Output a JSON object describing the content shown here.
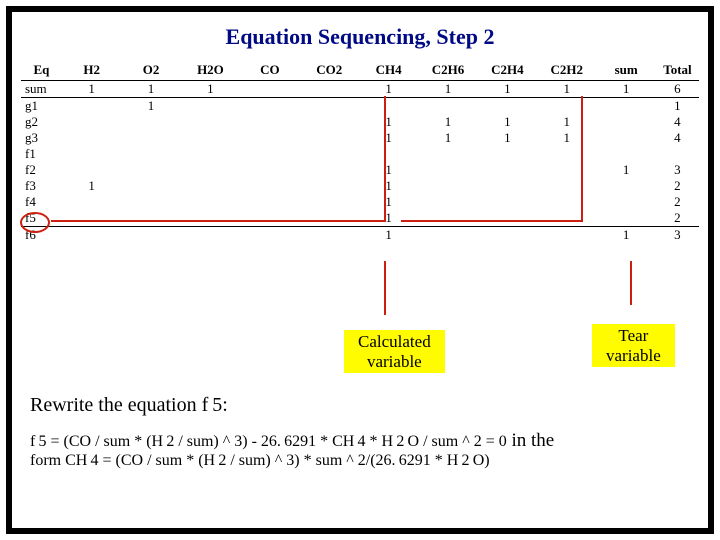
{
  "title": "Equation Sequencing, Step 2",
  "headers": [
    "Eq",
    "H2",
    "O2",
    "H2O",
    "CO",
    "CO2",
    "CH4",
    "C2H6",
    "C2H4",
    "C2H2",
    "sum",
    "Total"
  ],
  "rows": [
    {
      "k": "sum",
      "h2": "1",
      "o2": "1",
      "h2o": "1",
      "co": "",
      "co2": "",
      "ch4": "1",
      "c2h6": "1",
      "c2h4": "1",
      "c2h2": "1",
      "sm": "1",
      "tot": "6"
    },
    {
      "k": "g1",
      "h2": "",
      "o2": "1",
      "h2o": "",
      "co": "",
      "co2": "",
      "ch4": "",
      "c2h6": "",
      "c2h4": "",
      "c2h2": "",
      "sm": "",
      "tot": "1"
    },
    {
      "k": "g2",
      "h2": "",
      "o2": "",
      "h2o": "",
      "co": "",
      "co2": "",
      "ch4": "1",
      "c2h6": "1",
      "c2h4": "1",
      "c2h2": "1",
      "sm": "",
      "tot": "4"
    },
    {
      "k": "g3",
      "h2": "",
      "o2": "",
      "h2o": "",
      "co": "",
      "co2": "",
      "ch4": "1",
      "c2h6": "1",
      "c2h4": "1",
      "c2h2": "1",
      "sm": "",
      "tot": "4"
    },
    {
      "k": "f1",
      "h2": "",
      "o2": "",
      "h2o": "",
      "co": "",
      "co2": "",
      "ch4": "",
      "c2h6": "",
      "c2h4": "",
      "c2h2": "",
      "sm": "",
      "tot": ""
    },
    {
      "k": "f2",
      "h2": "",
      "o2": "",
      "h2o": "",
      "co": "",
      "co2": "",
      "ch4": "1",
      "c2h6": "",
      "c2h4": "",
      "c2h2": "",
      "sm": "1",
      "tot": "3"
    },
    {
      "k": "f3",
      "h2": "1",
      "o2": "",
      "h2o": "",
      "co": "",
      "co2": "",
      "ch4": "1",
      "c2h6": "",
      "c2h4": "",
      "c2h2": "",
      "sm": "",
      "tot": "2"
    },
    {
      "k": "f4",
      "h2": "",
      "o2": "",
      "h2o": "",
      "co": "",
      "co2": "",
      "ch4": "1",
      "c2h6": "",
      "c2h4": "",
      "c2h2": "",
      "sm": "",
      "tot": "2"
    },
    {
      "k": "f5",
      "h2": "",
      "o2": "",
      "h2o": "",
      "co": "",
      "co2": "",
      "ch4": "1",
      "c2h6": "",
      "c2h4": "",
      "c2h2": "",
      "sm": "",
      "tot": "2"
    },
    {
      "k": "f6",
      "h2": "",
      "o2": "",
      "h2o": "",
      "co": "",
      "co2": "",
      "ch4": "1",
      "c2h6": "",
      "c2h4": "",
      "c2h2": "",
      "sm": "1",
      "tot": "3"
    }
  ],
  "labels": {
    "calculated_l1": "Calculated",
    "calculated_l2": "variable",
    "tear_l1": "Tear",
    "tear_l2": "variable"
  },
  "text": {
    "rewrite": "Rewrite the equation f 5:",
    "eq1a": "f 5 = (CO / sum * (H 2 / sum) ^ 3) - 26. 6291 * CH 4 * H 2 O / sum ^ 2 = 0",
    "eq1b": " in the",
    "eq2": "form CH 4 =  (CO / sum * (H 2 / sum) ^ 3) * sum ^ 2/(26. 6291 * H 2 O)"
  }
}
